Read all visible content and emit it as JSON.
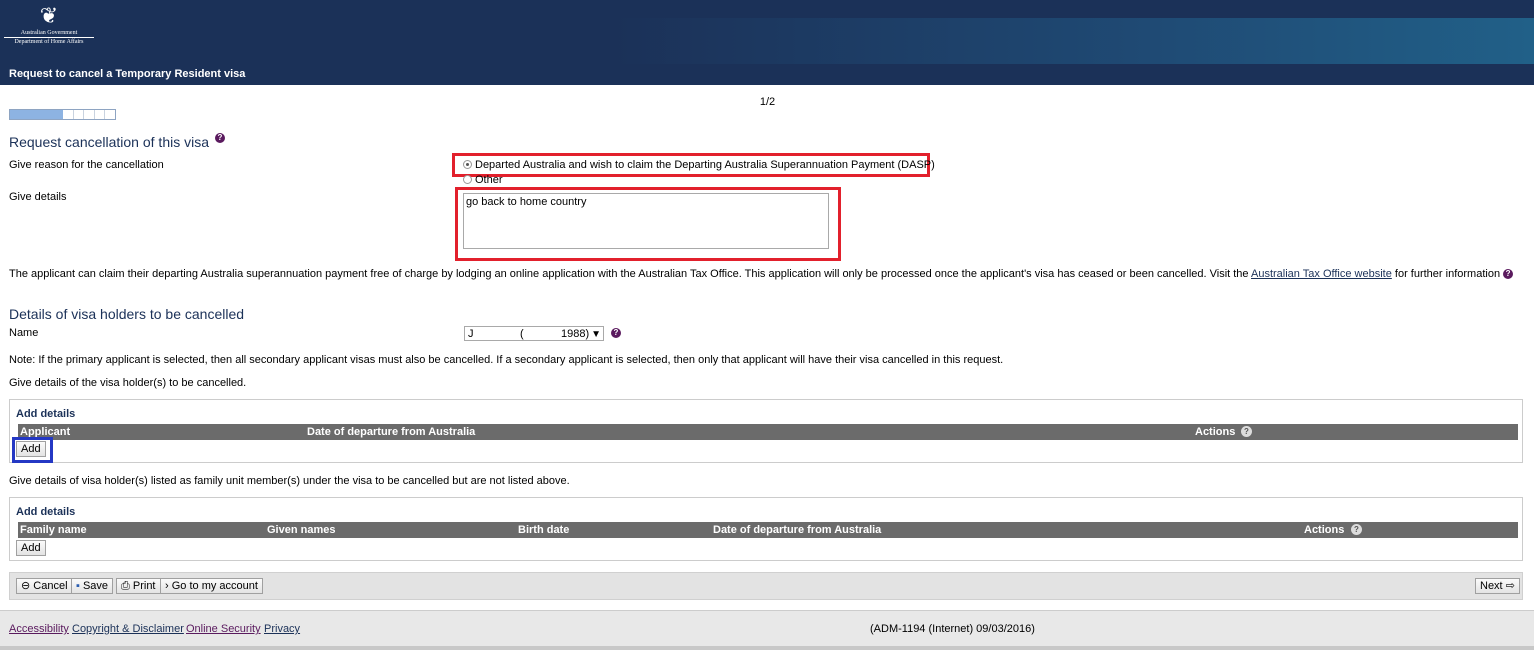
{
  "header": {
    "logo_line1": "Australian Government",
    "logo_line2": "Department of Home Affairs",
    "title": "Request to cancel a Temporary Resident visa"
  },
  "progress": {
    "page": "1/2",
    "fraction": 0.5
  },
  "section1": {
    "heading": "Request cancellation of this visa",
    "reason_label": "Give reason for the cancellation",
    "reason_options": [
      {
        "label": "Departed Australia and wish to claim the Departing Australia Superannuation Payment (DASP)",
        "selected": true
      },
      {
        "label": "Other",
        "selected": false
      }
    ],
    "details_label": "Give details",
    "details_value": "go back to home country",
    "info_text_before": "The applicant can claim their departing Australia superannuation payment free of charge by lodging an online application with the Australian Tax Office. This application will only be processed once the applicant's visa has ceased or been cancelled. Visit the ",
    "info_link": "Australian Tax Office website",
    "info_text_after": " for further information"
  },
  "section2": {
    "heading": "Details of visa holders to be cancelled",
    "name_label": "Name",
    "name_value_part1": "J",
    "name_value_part2": "(",
    "name_value_part3": "1988)",
    "note": "Note: If the primary applicant is selected, then all secondary applicant visas must also be cancelled. If a secondary applicant is selected, then only that applicant will have their visa cancelled in this request.",
    "give_details_holders": "Give details of the visa holder(s) to be cancelled.",
    "panel1": {
      "title": "Add details",
      "columns": [
        "Applicant",
        "Date of departure from Australia",
        "Actions"
      ],
      "add_label": "Add"
    },
    "give_details_family": "Give details of visa holder(s) listed as family unit member(s) under the visa to be cancelled but are not listed above.",
    "panel2": {
      "title": "Add details",
      "columns": [
        "Family name",
        "Given names",
        "Birth date",
        "Date of departure from Australia",
        "Actions"
      ],
      "add_label": "Add"
    }
  },
  "navbar": {
    "cancel": "Cancel",
    "save": "Save",
    "print": "Print",
    "account": "Go to my account",
    "next": "Next"
  },
  "footer": {
    "links": [
      "Accessibility",
      "Copyright & Disclaimer",
      "Online Security",
      "Privacy"
    ],
    "code": "(ADM-1194 (Internet) 09/03/2016)"
  },
  "colors": {
    "navy": "#1b3158",
    "highlight_red": "#e2202c",
    "highlight_blue": "#2438c4",
    "table_header": "#6b6b6b"
  }
}
